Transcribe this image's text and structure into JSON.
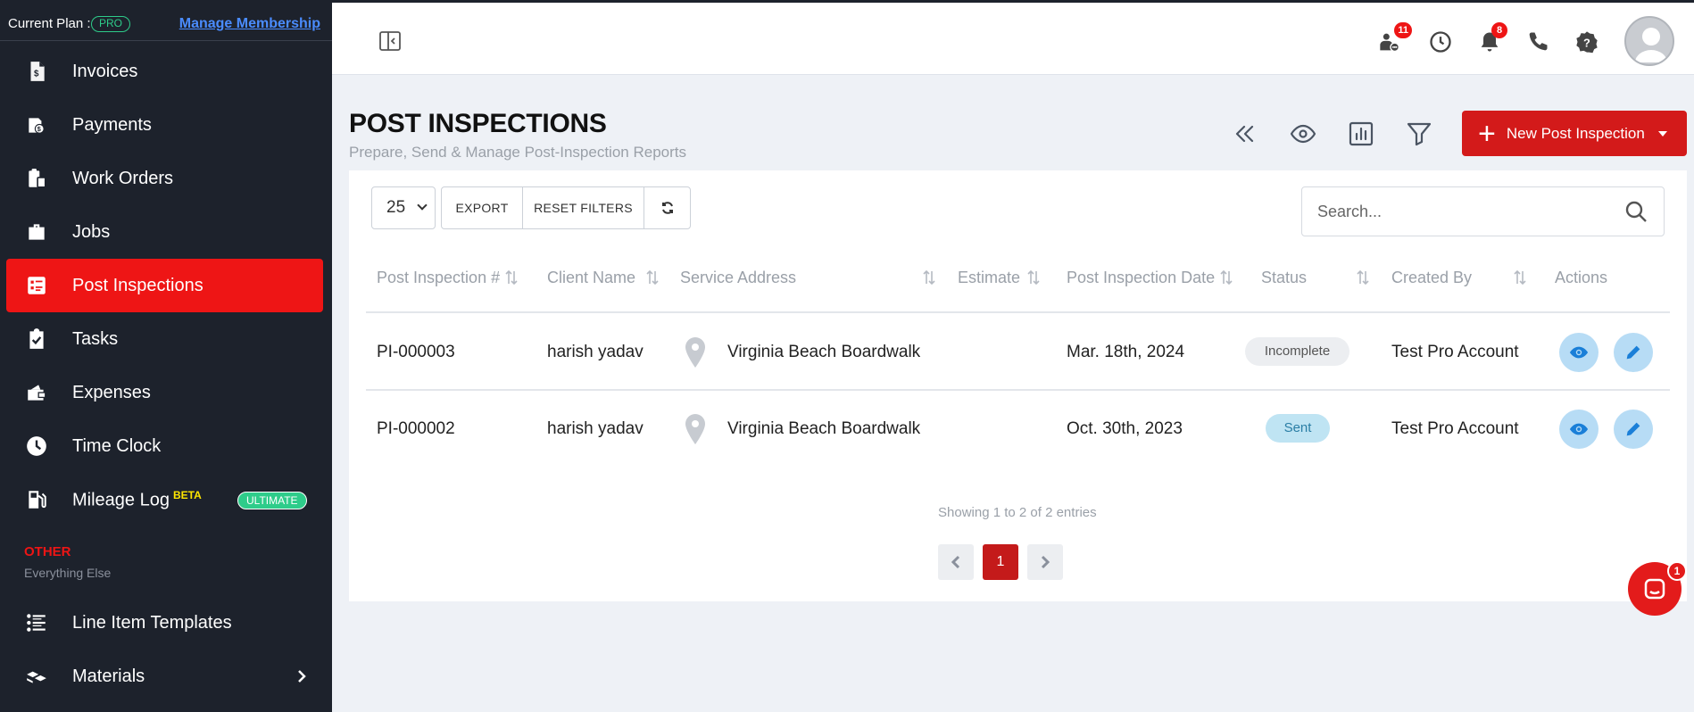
{
  "sidebar": {
    "plan_label": "Current Plan :",
    "plan_badge": "PRO",
    "manage_link": "Manage Membership",
    "items": [
      {
        "label": "Invoices",
        "icon": "invoice-icon"
      },
      {
        "label": "Payments",
        "icon": "payments-icon"
      },
      {
        "label": "Work Orders",
        "icon": "work-orders-icon"
      },
      {
        "label": "Jobs",
        "icon": "briefcase-icon"
      },
      {
        "label": "Post Inspections",
        "icon": "post-inspection-icon",
        "active": true
      },
      {
        "label": "Tasks",
        "icon": "clipboard-check-icon"
      },
      {
        "label": "Expenses",
        "icon": "wallet-icon"
      },
      {
        "label": "Time Clock",
        "icon": "clock-icon"
      },
      {
        "label": "Mileage Log",
        "icon": "fuel-icon",
        "beta": "BETA",
        "badge": "ULTIMATE"
      }
    ],
    "section_title": "OTHER",
    "section_sub": "Everything Else",
    "other_items": [
      {
        "label": "Line Item Templates",
        "icon": "list-icon"
      },
      {
        "label": "Materials",
        "icon": "materials-icon"
      }
    ]
  },
  "topbar": {
    "team_badge": "11",
    "notif_badge": "8"
  },
  "page": {
    "title": "POST INSPECTIONS",
    "subtitle": "Prepare, Send & Manage Post-Inspection Reports",
    "new_button": "New Post Inspection"
  },
  "toolbar": {
    "per_page": "25",
    "export": "EXPORT",
    "reset": "RESET FILTERS",
    "search_placeholder": "Search..."
  },
  "table": {
    "headers": [
      "Post Inspection #",
      "Client Name",
      "Service Address",
      "Estimate",
      "Post Inspection Date",
      "Status",
      "Created By",
      "Actions"
    ],
    "rows": [
      {
        "id": "PI-000003",
        "client": "harish yadav",
        "address": "Virginia Beach Boardwalk",
        "estimate": "",
        "date": "Mar. 18th, 2024",
        "status": "Incomplete",
        "created_by": "Test Pro Account"
      },
      {
        "id": "PI-000002",
        "client": "harish yadav",
        "address": "Virginia Beach Boardwalk",
        "estimate": "",
        "date": "Oct. 30th, 2023",
        "status": "Sent",
        "created_by": "Test Pro Account"
      }
    ]
  },
  "footer": {
    "showing": "Showing 1 to 2 of 2 entries",
    "page": "1"
  },
  "chat": {
    "badge": "1"
  },
  "colors": {
    "sidebar_bg": "#1d222c",
    "accent": "#ee1515",
    "primary_button": "#d31a1a",
    "pro_green": "#2ecc8a"
  }
}
